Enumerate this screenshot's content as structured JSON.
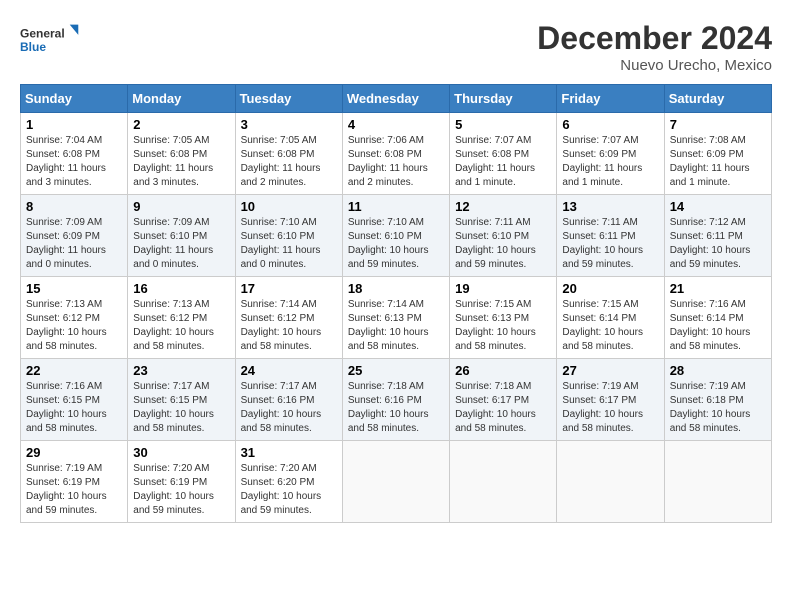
{
  "logo": {
    "text1": "General",
    "text2": "Blue"
  },
  "title": "December 2024",
  "location": "Nuevo Urecho, Mexico",
  "weekdays": [
    "Sunday",
    "Monday",
    "Tuesday",
    "Wednesday",
    "Thursday",
    "Friday",
    "Saturday"
  ],
  "weeks": [
    [
      {
        "day": "1",
        "sunrise": "Sunrise: 7:04 AM",
        "sunset": "Sunset: 6:08 PM",
        "daylight": "Daylight: 11 hours and 3 minutes."
      },
      {
        "day": "2",
        "sunrise": "Sunrise: 7:05 AM",
        "sunset": "Sunset: 6:08 PM",
        "daylight": "Daylight: 11 hours and 3 minutes."
      },
      {
        "day": "3",
        "sunrise": "Sunrise: 7:05 AM",
        "sunset": "Sunset: 6:08 PM",
        "daylight": "Daylight: 11 hours and 2 minutes."
      },
      {
        "day": "4",
        "sunrise": "Sunrise: 7:06 AM",
        "sunset": "Sunset: 6:08 PM",
        "daylight": "Daylight: 11 hours and 2 minutes."
      },
      {
        "day": "5",
        "sunrise": "Sunrise: 7:07 AM",
        "sunset": "Sunset: 6:08 PM",
        "daylight": "Daylight: 11 hours and 1 minute."
      },
      {
        "day": "6",
        "sunrise": "Sunrise: 7:07 AM",
        "sunset": "Sunset: 6:09 PM",
        "daylight": "Daylight: 11 hours and 1 minute."
      },
      {
        "day": "7",
        "sunrise": "Sunrise: 7:08 AM",
        "sunset": "Sunset: 6:09 PM",
        "daylight": "Daylight: 11 hours and 1 minute."
      }
    ],
    [
      {
        "day": "8",
        "sunrise": "Sunrise: 7:09 AM",
        "sunset": "Sunset: 6:09 PM",
        "daylight": "Daylight: 11 hours and 0 minutes."
      },
      {
        "day": "9",
        "sunrise": "Sunrise: 7:09 AM",
        "sunset": "Sunset: 6:10 PM",
        "daylight": "Daylight: 11 hours and 0 minutes."
      },
      {
        "day": "10",
        "sunrise": "Sunrise: 7:10 AM",
        "sunset": "Sunset: 6:10 PM",
        "daylight": "Daylight: 11 hours and 0 minutes."
      },
      {
        "day": "11",
        "sunrise": "Sunrise: 7:10 AM",
        "sunset": "Sunset: 6:10 PM",
        "daylight": "Daylight: 10 hours and 59 minutes."
      },
      {
        "day": "12",
        "sunrise": "Sunrise: 7:11 AM",
        "sunset": "Sunset: 6:10 PM",
        "daylight": "Daylight: 10 hours and 59 minutes."
      },
      {
        "day": "13",
        "sunrise": "Sunrise: 7:11 AM",
        "sunset": "Sunset: 6:11 PM",
        "daylight": "Daylight: 10 hours and 59 minutes."
      },
      {
        "day": "14",
        "sunrise": "Sunrise: 7:12 AM",
        "sunset": "Sunset: 6:11 PM",
        "daylight": "Daylight: 10 hours and 59 minutes."
      }
    ],
    [
      {
        "day": "15",
        "sunrise": "Sunrise: 7:13 AM",
        "sunset": "Sunset: 6:12 PM",
        "daylight": "Daylight: 10 hours and 58 minutes."
      },
      {
        "day": "16",
        "sunrise": "Sunrise: 7:13 AM",
        "sunset": "Sunset: 6:12 PM",
        "daylight": "Daylight: 10 hours and 58 minutes."
      },
      {
        "day": "17",
        "sunrise": "Sunrise: 7:14 AM",
        "sunset": "Sunset: 6:12 PM",
        "daylight": "Daylight: 10 hours and 58 minutes."
      },
      {
        "day": "18",
        "sunrise": "Sunrise: 7:14 AM",
        "sunset": "Sunset: 6:13 PM",
        "daylight": "Daylight: 10 hours and 58 minutes."
      },
      {
        "day": "19",
        "sunrise": "Sunrise: 7:15 AM",
        "sunset": "Sunset: 6:13 PM",
        "daylight": "Daylight: 10 hours and 58 minutes."
      },
      {
        "day": "20",
        "sunrise": "Sunrise: 7:15 AM",
        "sunset": "Sunset: 6:14 PM",
        "daylight": "Daylight: 10 hours and 58 minutes."
      },
      {
        "day": "21",
        "sunrise": "Sunrise: 7:16 AM",
        "sunset": "Sunset: 6:14 PM",
        "daylight": "Daylight: 10 hours and 58 minutes."
      }
    ],
    [
      {
        "day": "22",
        "sunrise": "Sunrise: 7:16 AM",
        "sunset": "Sunset: 6:15 PM",
        "daylight": "Daylight: 10 hours and 58 minutes."
      },
      {
        "day": "23",
        "sunrise": "Sunrise: 7:17 AM",
        "sunset": "Sunset: 6:15 PM",
        "daylight": "Daylight: 10 hours and 58 minutes."
      },
      {
        "day": "24",
        "sunrise": "Sunrise: 7:17 AM",
        "sunset": "Sunset: 6:16 PM",
        "daylight": "Daylight: 10 hours and 58 minutes."
      },
      {
        "day": "25",
        "sunrise": "Sunrise: 7:18 AM",
        "sunset": "Sunset: 6:16 PM",
        "daylight": "Daylight: 10 hours and 58 minutes."
      },
      {
        "day": "26",
        "sunrise": "Sunrise: 7:18 AM",
        "sunset": "Sunset: 6:17 PM",
        "daylight": "Daylight: 10 hours and 58 minutes."
      },
      {
        "day": "27",
        "sunrise": "Sunrise: 7:19 AM",
        "sunset": "Sunset: 6:17 PM",
        "daylight": "Daylight: 10 hours and 58 minutes."
      },
      {
        "day": "28",
        "sunrise": "Sunrise: 7:19 AM",
        "sunset": "Sunset: 6:18 PM",
        "daylight": "Daylight: 10 hours and 58 minutes."
      }
    ],
    [
      {
        "day": "29",
        "sunrise": "Sunrise: 7:19 AM",
        "sunset": "Sunset: 6:19 PM",
        "daylight": "Daylight: 10 hours and 59 minutes."
      },
      {
        "day": "30",
        "sunrise": "Sunrise: 7:20 AM",
        "sunset": "Sunset: 6:19 PM",
        "daylight": "Daylight: 10 hours and 59 minutes."
      },
      {
        "day": "31",
        "sunrise": "Sunrise: 7:20 AM",
        "sunset": "Sunset: 6:20 PM",
        "daylight": "Daylight: 10 hours and 59 minutes."
      },
      null,
      null,
      null,
      null
    ]
  ]
}
